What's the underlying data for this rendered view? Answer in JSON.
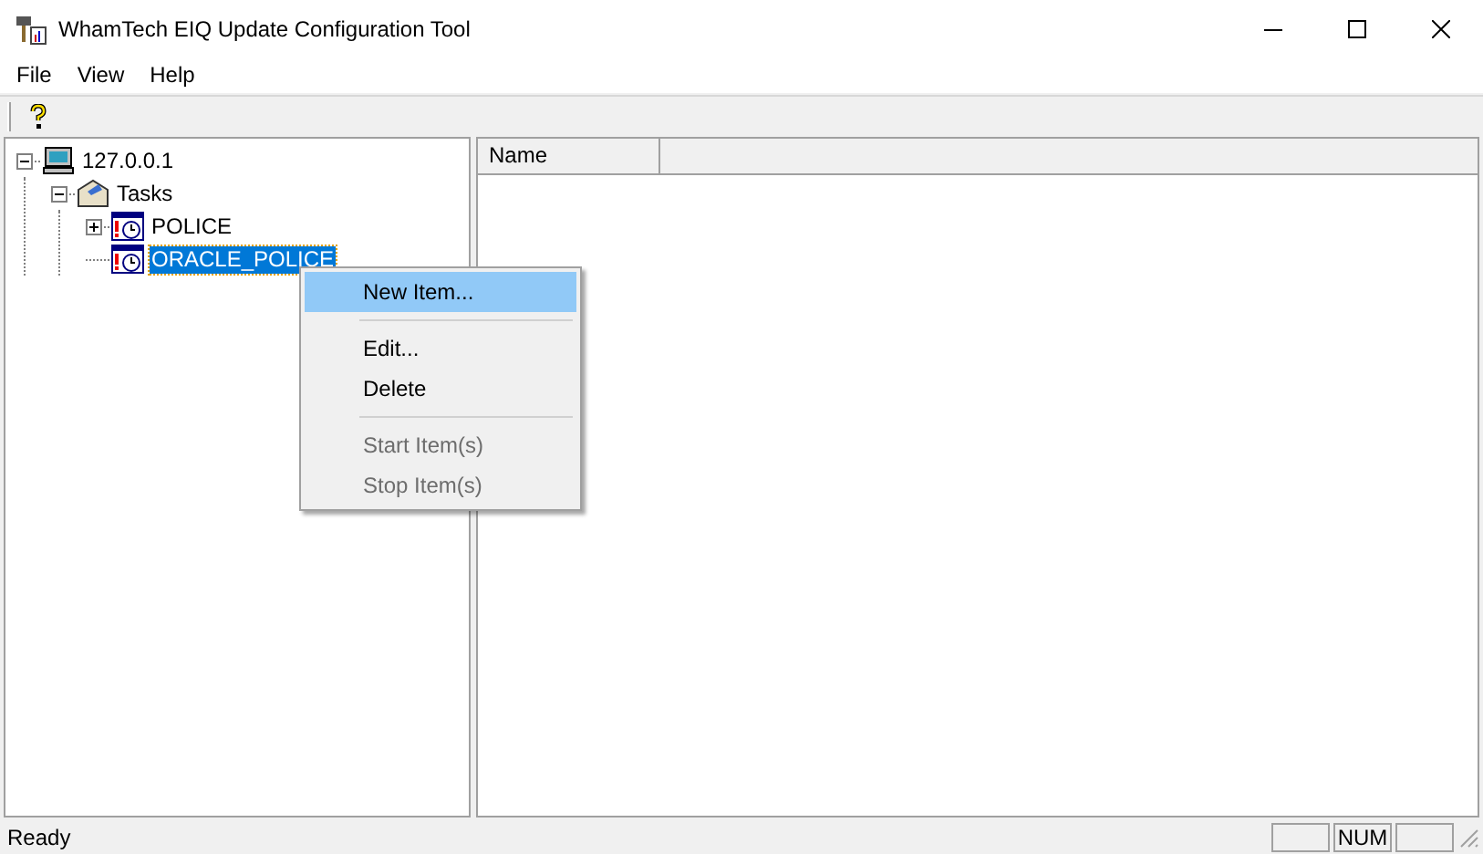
{
  "window": {
    "title": "WhamTech EIQ Update Configuration Tool"
  },
  "menu": [
    "File",
    "View",
    "Help"
  ],
  "tree": [
    {
      "label": "127.0.0.1",
      "kind": "computer",
      "has_children": true,
      "expanded": true,
      "selected": false,
      "children": [
        {
          "label": "Tasks",
          "kind": "folder",
          "has_children": true,
          "expanded": true,
          "selected": false,
          "children": [
            {
              "label": "POLICE",
              "kind": "task",
              "has_children": true,
              "expanded": false,
              "selected": false
            },
            {
              "label": "ORACLE_POLICE",
              "kind": "task",
              "has_children": false,
              "selected": true
            }
          ]
        }
      ]
    }
  ],
  "list": {
    "columns": [
      "Name"
    ]
  },
  "context_menu": [
    {
      "kind": "item",
      "label": "New Item...",
      "selected": true,
      "disabled": false
    },
    {
      "kind": "separator"
    },
    {
      "kind": "item",
      "label": "Edit...",
      "selected": false,
      "disabled": false
    },
    {
      "kind": "item",
      "label": "Delete",
      "selected": false,
      "disabled": false
    },
    {
      "kind": "separator"
    },
    {
      "kind": "item",
      "label": "Start Item(s)",
      "selected": false,
      "disabled": true
    },
    {
      "kind": "item",
      "label": "Stop Item(s)",
      "selected": false,
      "disabled": true
    }
  ],
  "status_bar": {
    "text": "Ready",
    "panes": [
      {
        "kind": "empty"
      },
      {
        "kind": "indicator",
        "text": "NUM"
      },
      {
        "kind": "empty"
      }
    ]
  }
}
